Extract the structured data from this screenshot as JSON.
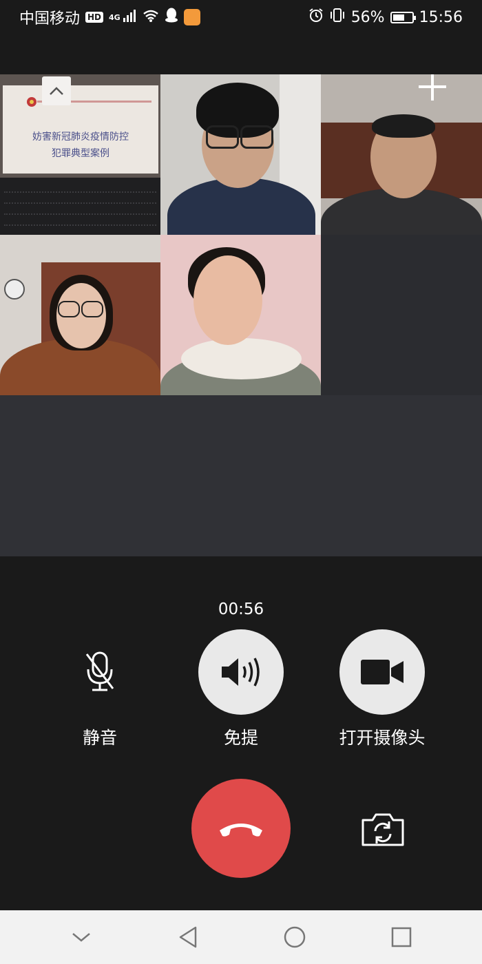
{
  "status_bar": {
    "carrier": "中国移动",
    "hd_badge": "HD",
    "network_type": "4G",
    "battery_percent": "56%",
    "time": "15:56",
    "icons": [
      "signal-icon",
      "wifi-icon",
      "qq-icon",
      "app-notification-icon",
      "alarm-icon",
      "vibrate-icon",
      "battery-icon"
    ]
  },
  "video_grid": {
    "shared_slide": {
      "line1": "妨害新冠肺炎疫情防控",
      "line2": "犯罪典型案例"
    }
  },
  "call": {
    "duration": "00:56",
    "mute_label": "静音",
    "speaker_label": "免提",
    "camera_label": "打开摄像头"
  },
  "colors": {
    "background": "#1a1a1a",
    "hangup": "#e04a4a",
    "control_circle": "#e9e9e9",
    "empty_tile": "#2b2c30",
    "nav_bar": "#f2f2f2"
  }
}
